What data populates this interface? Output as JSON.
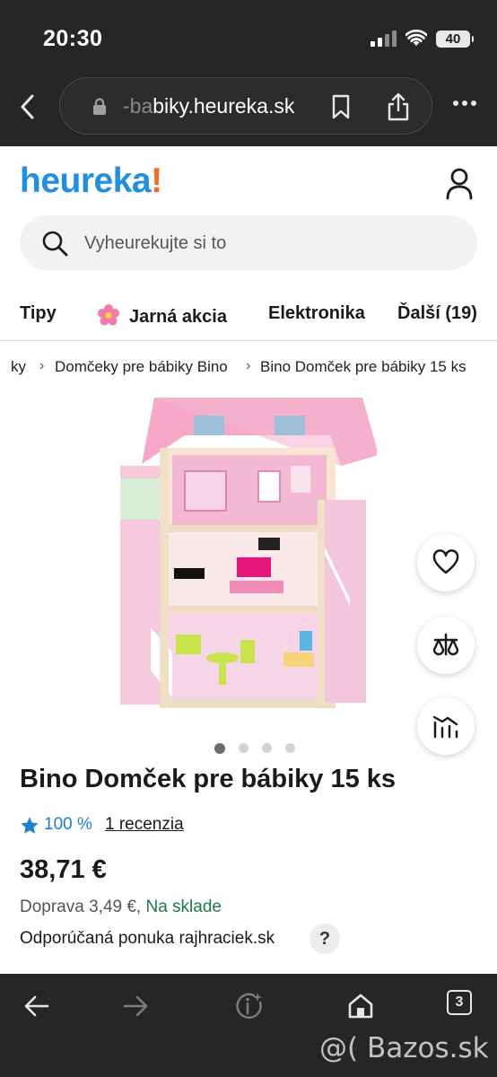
{
  "status_bar": {
    "time": "20:30",
    "battery": "40"
  },
  "browser": {
    "url_faded": "-ba",
    "url_main": "biky.heureka.sk"
  },
  "header": {
    "logo_main": "heureka",
    "logo_mark": "!"
  },
  "search": {
    "placeholder": "Vyheurekujte si to"
  },
  "categories": [
    "Tipy",
    "Jarná akcia",
    "Elektronika",
    "Ďalší (19)"
  ],
  "breadcrumb": [
    "ky",
    "Domčeky pre bábiky Bino",
    "Bino Domček pre bábiky 15 ks"
  ],
  "gallery": {
    "slide_count": 4,
    "active_slide": 1
  },
  "product": {
    "title": "Bino Domček pre bábiky 15 ks",
    "rating": "100 %",
    "reviews": "1 recenzia",
    "price": "38,71 €",
    "shipping": "Doprava 3,49 €,",
    "availability": "Na sklade",
    "offer": "Odporúčaná ponuka rajhraciek.sk",
    "help": "?"
  },
  "toolbar": {
    "tabs_count": "3"
  },
  "watermark": "@( Bazos.sk",
  "colors": {
    "brand_blue": "#1e8fe1",
    "brand_orange": "#f46b1e",
    "stock_green": "#1e7a47",
    "chrome_dark": "#262628"
  }
}
